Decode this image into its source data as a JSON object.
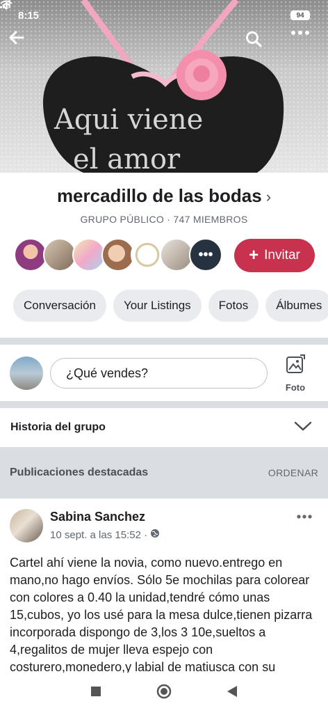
{
  "status_bar": {
    "time": "8:15",
    "battery": "94"
  },
  "cover": {
    "chalk_line1": "Aqui viene",
    "chalk_line2": "el amor"
  },
  "group": {
    "name": "mercadillo de las bodas",
    "subtitle": "GRUPO PÚBLICO · 747 MIEMBROS",
    "invite_label": "Invitar",
    "more_members": "•••"
  },
  "tabs": [
    "Conversación",
    "Your Listings",
    "Fotos",
    "Álbumes"
  ],
  "composer": {
    "placeholder": "¿Qué vendes?",
    "photo_label": "Foto"
  },
  "history": {
    "label": "Historia del grupo"
  },
  "featured": {
    "label": "Publicaciones destacadas",
    "order_label": "ORDENAR"
  },
  "post": {
    "author": "Sabina Sanchez",
    "timestamp": "10 sept. a las 15:52 ·",
    "text": "Cartel ahí viene la novia, como nuevo.entrego en mano,no hago envíos. Sólo 5e mochilas para colorear con colores a 0.40 la unidad,tendré cómo unas 15,cubos, yo los usé para la mesa dulce,tienen pizarra incorporada dispongo de 3,los 3 10e,sueltos a 4,regalitos de mujer lleva espejo con costurero,monedero,y labial de matiusca con su"
  },
  "colors": {
    "accent": "#c8324f",
    "divider": "#dadde1",
    "chip_bg": "#e9ebee"
  },
  "icons": {
    "back": "back-arrow-icon",
    "search": "search-icon",
    "more": "more-icon",
    "photo": "photo-icon",
    "history_chevron": "chevron-down-icon",
    "globe": "globe-icon"
  }
}
